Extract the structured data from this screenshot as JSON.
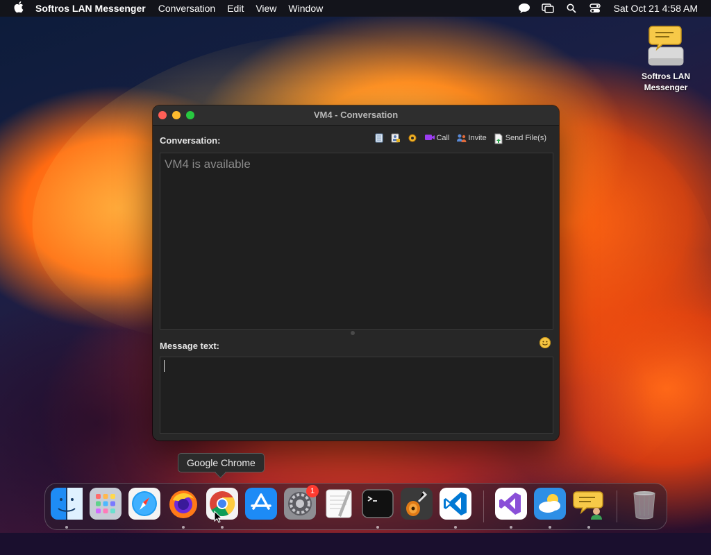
{
  "menubar": {
    "app_name": "Softros LAN Messenger",
    "menus": [
      "Conversation",
      "Edit",
      "View",
      "Window"
    ],
    "clock": "Sat Oct 21  4:58 AM",
    "status_icons": [
      "chat-bubble-icon",
      "screen-mirror-icon",
      "search-icon",
      "control-center-icon"
    ]
  },
  "desktop": {
    "icon_label": "Softros LAN Messenger"
  },
  "window": {
    "title": "VM4 - Conversation",
    "conversation_label": "Conversation:",
    "toolbar": {
      "call_label": "Call",
      "invite_label": "Invite",
      "send_files_label": "Send File(s)"
    },
    "status_text": "VM4 is available",
    "message_label": "Message text:",
    "message_value": ""
  },
  "tooltip": {
    "text": "Google Chrome"
  },
  "dock": {
    "items": [
      {
        "name": "Finder",
        "icon": "finder-icon",
        "running": true
      },
      {
        "name": "Launchpad",
        "icon": "launchpad-icon",
        "running": false
      },
      {
        "name": "Safari",
        "icon": "safari-icon",
        "running": false
      },
      {
        "name": "Firefox",
        "icon": "firefox-icon",
        "running": true
      },
      {
        "name": "Google Chrome",
        "icon": "chrome-icon",
        "running": true
      },
      {
        "name": "App Store",
        "icon": "app-store-icon",
        "running": false
      },
      {
        "name": "System Settings",
        "icon": "system-settings-icon",
        "running": false,
        "badge": "1"
      },
      {
        "name": "TextEdit",
        "icon": "textedit-icon",
        "running": false
      },
      {
        "name": "Terminal",
        "icon": "terminal-icon",
        "running": true
      },
      {
        "name": "GarageBand",
        "icon": "garageband-icon",
        "running": false
      },
      {
        "name": "Visual Studio Code",
        "icon": "vscode-icon",
        "running": true
      },
      {
        "name": "Visual Studio",
        "icon": "visual-studio-icon",
        "running": true
      },
      {
        "name": "Weather",
        "icon": "weather-icon",
        "running": true
      },
      {
        "name": "Softros LAN Messenger",
        "icon": "softros-messenger-icon",
        "running": true
      },
      {
        "name": "Trash",
        "icon": "trash-icon",
        "running": false
      }
    ]
  },
  "colors": {
    "window_bg": "#272727",
    "text_area_bg": "#1f1f1f",
    "traffic_red": "#ff5f57",
    "traffic_yellow": "#febc2e",
    "traffic_green": "#28c840"
  }
}
